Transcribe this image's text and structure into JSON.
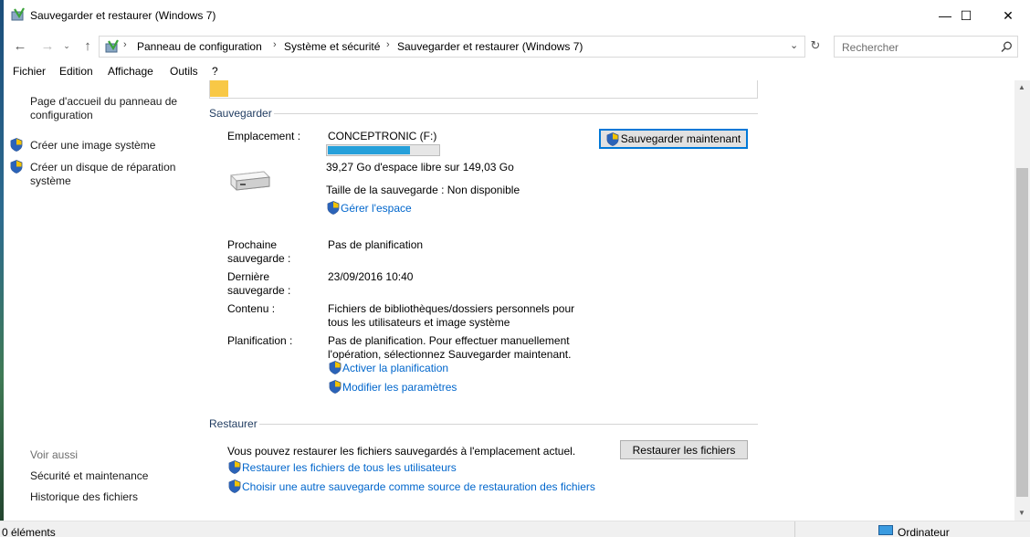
{
  "window": {
    "title": "Sauvegarder et restaurer (Windows 7)",
    "minimize": "—",
    "maximize": "☐",
    "close": "✕"
  },
  "address": {
    "crumbs": [
      "Panneau de configuration",
      "Système et sécurité",
      "Sauvegarder et restaurer (Windows 7)"
    ],
    "search_placeholder": "Rechercher"
  },
  "menu": [
    "Fichier",
    "Edition",
    "Affichage",
    "Outils",
    "?"
  ],
  "left_pane": {
    "home_link": "Page d'accueil du panneau de configuration",
    "links": [
      "Créer une image système",
      "Créer un disque de réparation système"
    ],
    "see_also_title": "Voir aussi",
    "see_also": [
      "Sécurité et maintenance",
      "Historique des fichiers"
    ]
  },
  "backup": {
    "section_title": "Sauvegarder",
    "location_label": "Emplacement :",
    "drive_name": "CONCEPTRONIC (F:)",
    "drive_usage_fraction": 0.74,
    "free_space": "39,27 Go d'espace libre sur 149,03 Go",
    "backup_size": "Taille de la sauvegarde : Non disponible",
    "manage_space_link": "Gérer l'espace",
    "backup_now_button": "Sauvegarder maintenant",
    "next_backup_label": "Prochaine sauvegarde :",
    "next_backup_value": "Pas de planification",
    "last_backup_label": "Dernière sauvegarde :",
    "last_backup_value": "23/09/2016 10:40",
    "contents_label": "Contenu :",
    "contents_value": "Fichiers de bibliothèques/dossiers personnels pour tous les utilisateurs et image système",
    "schedule_label": "Planification :",
    "schedule_value": "Pas de planification. Pour effectuer manuellement l'opération, sélectionnez Sauvegarder maintenant.",
    "enable_schedule_link": "Activer la planification",
    "change_settings_link": "Modifier les paramètres"
  },
  "restore": {
    "section_title": "Restaurer",
    "description": "Vous pouvez restaurer les fichiers sauvegardés à l'emplacement actuel.",
    "restore_button": "Restaurer les fichiers",
    "all_users_link": "Restaurer les fichiers de tous les utilisateurs",
    "choose_other_link": "Choisir une autre sauvegarde comme source de restauration des fichiers"
  },
  "status": {
    "items_count": "0 éléments",
    "location": "Ordinateur"
  },
  "colors": {
    "link": "#0066cc",
    "progress_fill": "#26a0da",
    "button_focus": "#0078d7"
  }
}
